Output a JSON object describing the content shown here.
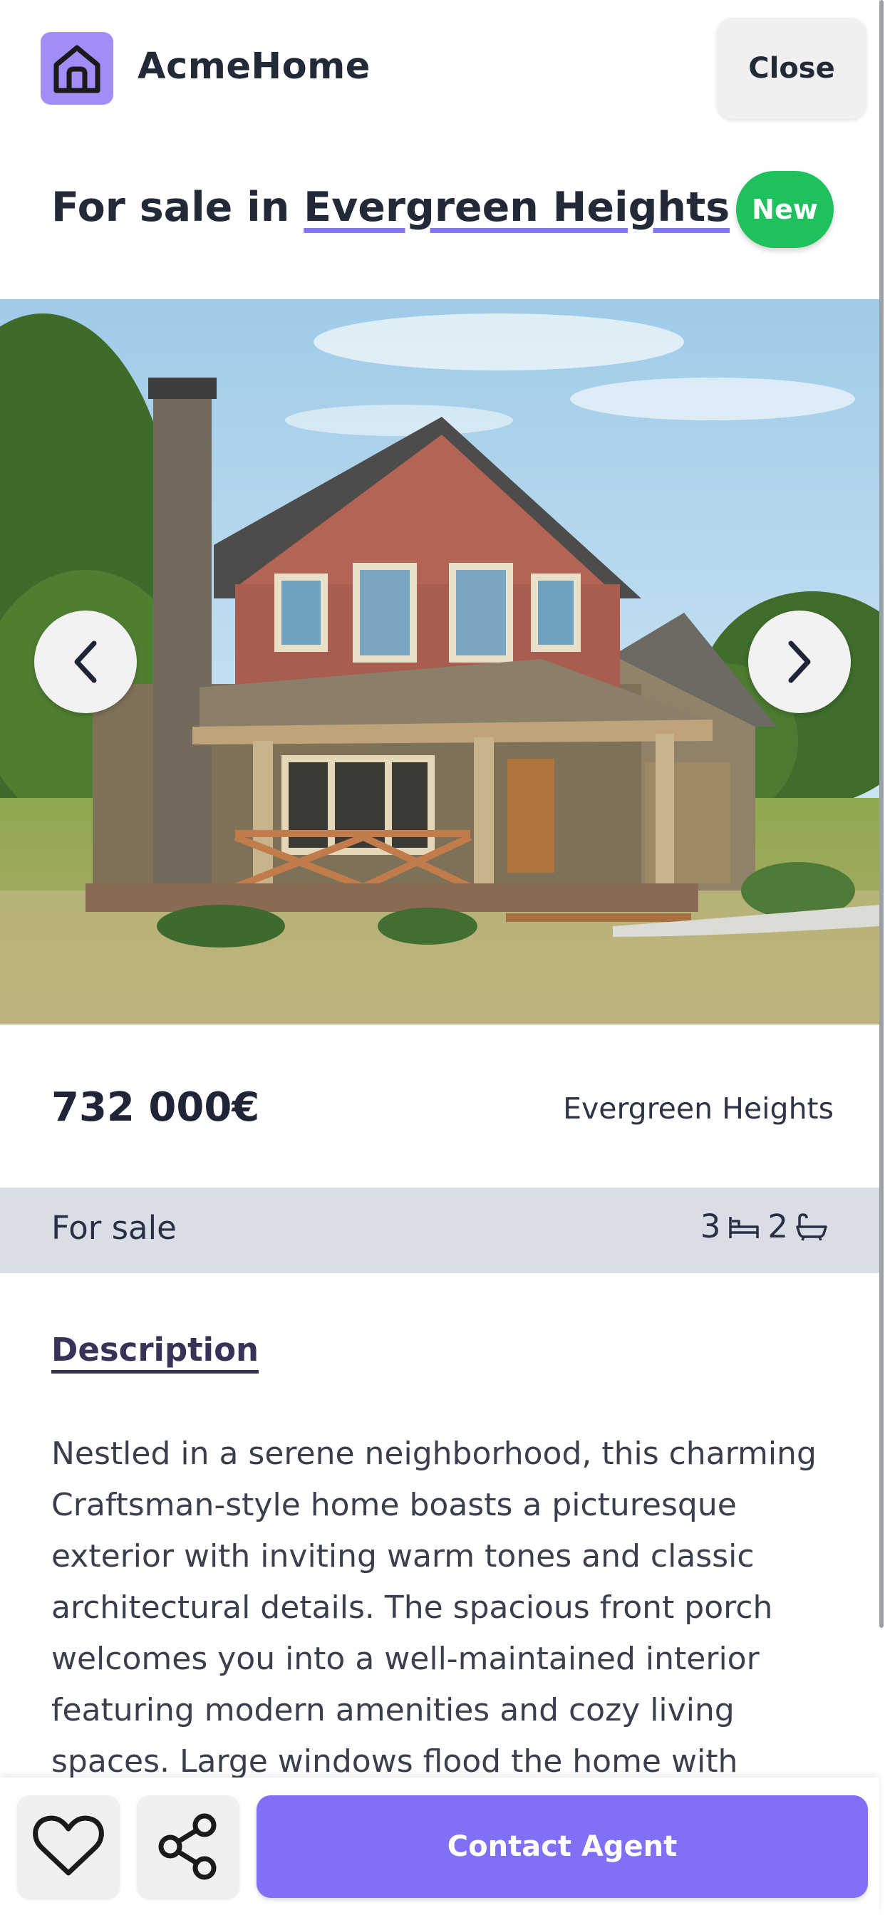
{
  "app": {
    "brand": "AcmeHome",
    "logo_icon": "home-icon"
  },
  "header": {
    "close_label": "Close"
  },
  "listing": {
    "title_prefix": "For sale in",
    "title_place": "Evergreen Heights",
    "badge": "New",
    "price": "732 000€",
    "location": "Evergreen Heights",
    "status": "For sale",
    "bedrooms": "3",
    "bathrooms": "2",
    "bed_icon": "bed-icon",
    "bath_icon": "bathtub-icon"
  },
  "gallery": {
    "prev_icon": "chevron-left-icon",
    "next_icon": "chevron-right-icon"
  },
  "description": {
    "title": "Description",
    "text": "Nestled in a serene neighborhood, this charming Craftsman-style home boasts a picturesque exterior with inviting warm tones and classic architectural details. The spacious front porch welcomes you into a well-maintained interior featuring modern amenities and cozy living spaces. Large windows flood the home with"
  },
  "actions": {
    "favorite_icon": "heart-icon",
    "share_icon": "share-icon",
    "contact_label": "Contact Agent"
  },
  "colors": {
    "accent": "#8070f6",
    "badge_green": "#1fc15c",
    "info_bar": "#d9dde5",
    "logo_bg": "#a28cf6"
  }
}
